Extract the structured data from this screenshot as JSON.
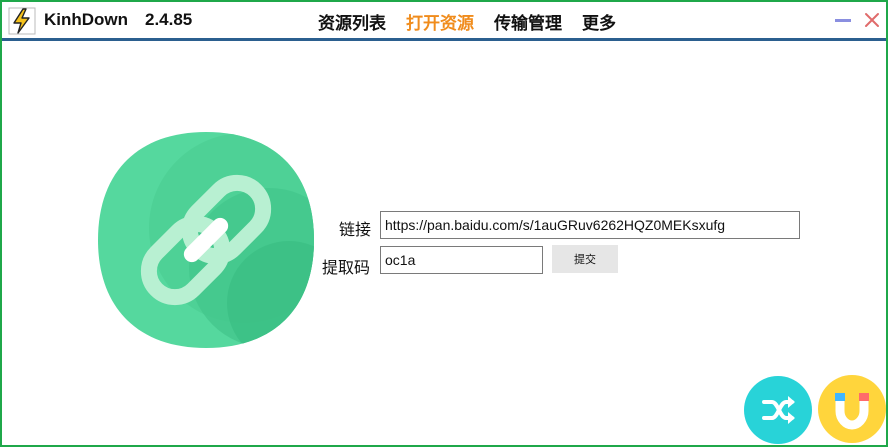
{
  "app": {
    "name": "KinhDown",
    "version": "2.4.85",
    "logo_icon": "lightning-bolt-icon"
  },
  "nav": {
    "items": [
      {
        "label": "资源列表",
        "active": false
      },
      {
        "label": "打开资源",
        "active": true
      },
      {
        "label": "传输管理",
        "active": false
      },
      {
        "label": "更多",
        "active": false
      }
    ]
  },
  "window_controls": {
    "minimize_icon": "minimize-icon",
    "close_icon": "close-icon"
  },
  "form": {
    "link_label": "链接",
    "link_value": "https://pan.baidu.com/s/1auGRuv6262HQZ0MEKsxufg",
    "code_label": "提取码",
    "code_value": "oc1a",
    "submit_label": "提交"
  },
  "hero": {
    "icon": "chain-link-icon"
  },
  "fabs": [
    {
      "icon": "shuffle-icon"
    },
    {
      "icon": "magnet-icon"
    }
  ],
  "colors": {
    "frame": "#1fa84a",
    "titlebar_line": "#2b5f8f",
    "active_nav": "#f08c1c",
    "hero_green": "#4fd69a",
    "shuffle_bg": "#28d3d8",
    "magnet_bg": "#ffd53c"
  }
}
